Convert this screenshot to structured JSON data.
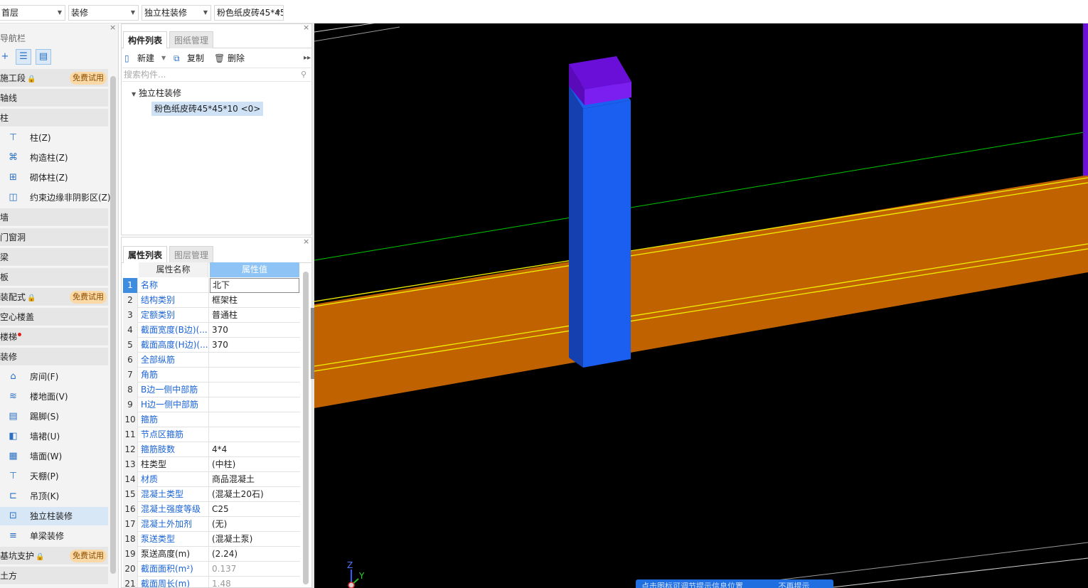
{
  "toolbar": {
    "floor": "首层",
    "category": "装修",
    "component_type": "独立柱装修",
    "component": "粉色纸皮砖45*45"
  },
  "nav": {
    "title": "导航栏",
    "close": "×",
    "items": [
      {
        "type": "cat",
        "label": "施工段",
        "badge": "免费试用",
        "lock": true
      },
      {
        "type": "cat",
        "label": "轴线"
      },
      {
        "type": "cat",
        "label": "柱"
      },
      {
        "type": "sub",
        "label": "柱(Z)",
        "icon": "column-icon"
      },
      {
        "type": "sub",
        "label": "构造柱(Z)",
        "icon": "construct-column-icon"
      },
      {
        "type": "sub",
        "label": "砌体柱(Z)",
        "icon": "masonry-column-icon"
      },
      {
        "type": "sub",
        "label": "约束边缘非阴影区(Z)",
        "icon": "constraint-edge-icon"
      },
      {
        "type": "cat",
        "label": "墙"
      },
      {
        "type": "cat",
        "label": "门窗洞"
      },
      {
        "type": "cat",
        "label": "梁"
      },
      {
        "type": "cat",
        "label": "板"
      },
      {
        "type": "cat",
        "label": "装配式",
        "badge": "免费试用",
        "lock": true
      },
      {
        "type": "cat",
        "label": "空心楼盖"
      },
      {
        "type": "cat",
        "label": "楼梯",
        "dot": true
      },
      {
        "type": "cat",
        "label": "装修"
      },
      {
        "type": "sub",
        "label": "房间(F)",
        "icon": "room-icon"
      },
      {
        "type": "sub",
        "label": "楼地面(V)",
        "icon": "floor-icon"
      },
      {
        "type": "sub",
        "label": "踢脚(S)",
        "icon": "skirting-icon"
      },
      {
        "type": "sub",
        "label": "墙裙(U)",
        "icon": "dado-icon"
      },
      {
        "type": "sub",
        "label": "墙面(W)",
        "icon": "wall-surface-icon"
      },
      {
        "type": "sub",
        "label": "天棚(P)",
        "icon": "ceiling-icon"
      },
      {
        "type": "sub",
        "label": "吊顶(K)",
        "icon": "suspended-ceiling-icon"
      },
      {
        "type": "sub",
        "label": "独立柱装修",
        "icon": "column-decoration-icon",
        "selected": true
      },
      {
        "type": "sub",
        "label": "单梁装修",
        "icon": "beam-decoration-icon"
      },
      {
        "type": "cat",
        "label": "基坑支护",
        "badge": "免费试用",
        "lock": true
      },
      {
        "type": "cat",
        "label": "土方"
      }
    ]
  },
  "component_list": {
    "tabs": [
      "构件列表",
      "图纸管理"
    ],
    "new_label": "新建",
    "copy_label": "复制",
    "delete_label": "删除",
    "search_placeholder": "搜索构件...",
    "tree_root": "独立柱装修",
    "tree_child": "粉色纸皮砖45*45*10 <0>"
  },
  "properties": {
    "tabs": [
      "属性列表",
      "图层管理"
    ],
    "header_name": "属性名称",
    "header_value": "属性值",
    "rows": [
      {
        "n": "1",
        "name": "名称",
        "value": "北下",
        "blue": true
      },
      {
        "n": "2",
        "name": "结构类别",
        "value": "框架柱",
        "blue": true
      },
      {
        "n": "3",
        "name": "定额类别",
        "value": "普通柱",
        "blue": true
      },
      {
        "n": "4",
        "name": "截面宽度(B边)(...",
        "value": "370",
        "blue": true
      },
      {
        "n": "5",
        "name": "截面高度(H边)(...",
        "value": "370",
        "blue": true
      },
      {
        "n": "6",
        "name": "全部纵筋",
        "value": "",
        "blue": true
      },
      {
        "n": "7",
        "name": "角筋",
        "value": "",
        "blue": true
      },
      {
        "n": "8",
        "name": "B边一侧中部筋",
        "value": "",
        "blue": true
      },
      {
        "n": "9",
        "name": "H边一侧中部筋",
        "value": "",
        "blue": true
      },
      {
        "n": "10",
        "name": "箍筋",
        "value": "",
        "blue": true
      },
      {
        "n": "11",
        "name": "节点区箍筋",
        "value": "",
        "blue": true
      },
      {
        "n": "12",
        "name": "箍筋肢数",
        "value": "4*4",
        "blue": true
      },
      {
        "n": "13",
        "name": "柱类型",
        "value": "(中柱)",
        "blue": false
      },
      {
        "n": "14",
        "name": "材质",
        "value": "商品混凝土",
        "blue": true
      },
      {
        "n": "15",
        "name": "混凝土类型",
        "value": "(混凝土20石)",
        "blue": true
      },
      {
        "n": "16",
        "name": "混凝土强度等级",
        "value": "C25",
        "blue": true
      },
      {
        "n": "17",
        "name": "混凝土外加剂",
        "value": "(无)",
        "blue": true
      },
      {
        "n": "18",
        "name": "泵送类型",
        "value": "(混凝土泵)",
        "blue": true
      },
      {
        "n": "19",
        "name": "泵送高度(m)",
        "value": "(2.24)",
        "blue": false
      },
      {
        "n": "20",
        "name": "截面面积(m²)",
        "value": "0.137",
        "blue": true,
        "gray": true
      },
      {
        "n": "21",
        "name": "截面周长(m)",
        "value": "1.48",
        "blue": true,
        "gray": true
      }
    ]
  },
  "viewport": {
    "axis_z": "Z",
    "axis_y": "Y",
    "hint": "点击图标可调节提示信息位置",
    "hint_dismiss": "不再提示",
    "colors": {
      "beam": "#c16200",
      "column": "#1a5ff0",
      "column_side": "#1540b0",
      "cap": "#6a0fd8",
      "highlight": "#f0f000",
      "axis": "#00c800"
    }
  }
}
